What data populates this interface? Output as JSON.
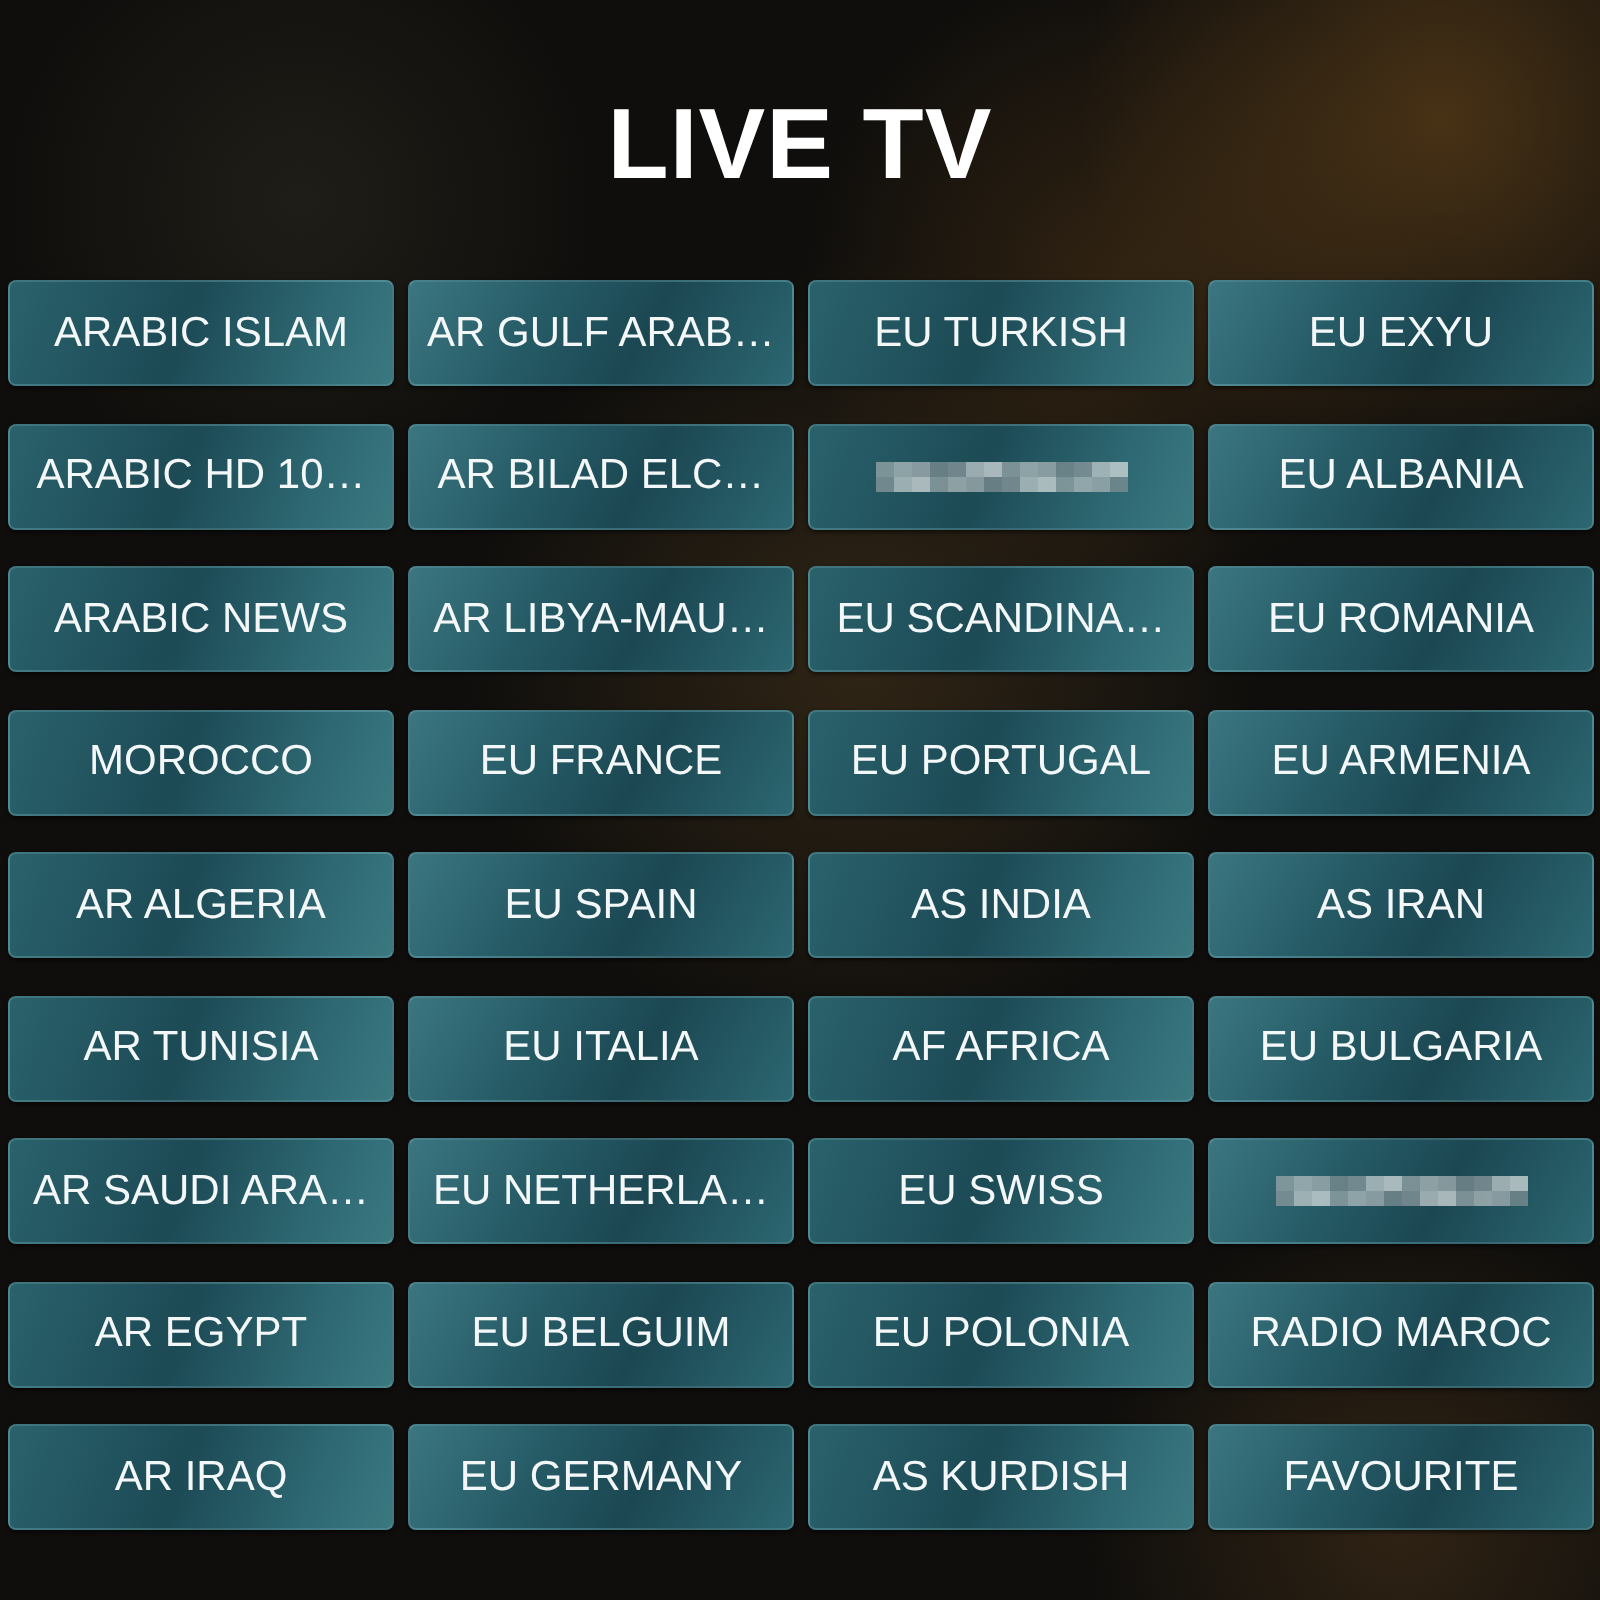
{
  "title": "LIVE TV",
  "categories": [
    {
      "kind": "label",
      "label": "ARABIC ISLAM"
    },
    {
      "kind": "label",
      "label": "AR GULF ARAB…"
    },
    {
      "kind": "label",
      "label": "EU TURKISH"
    },
    {
      "kind": "label",
      "label": "EU EXYU"
    },
    {
      "kind": "label",
      "label": "ARABIC HD 10…"
    },
    {
      "kind": "label",
      "label": "AR BILAD ELC…"
    },
    {
      "kind": "blurred"
    },
    {
      "kind": "label",
      "label": "EU ALBANIA"
    },
    {
      "kind": "label",
      "label": "ARABIC NEWS"
    },
    {
      "kind": "label",
      "label": "AR LIBYA-MAU…"
    },
    {
      "kind": "label",
      "label": "EU SCANDINA…"
    },
    {
      "kind": "label",
      "label": "EU ROMANIA"
    },
    {
      "kind": "label",
      "label": "MOROCCO"
    },
    {
      "kind": "label",
      "label": "EU FRANCE"
    },
    {
      "kind": "label",
      "label": "EU PORTUGAL"
    },
    {
      "kind": "label",
      "label": "EU ARMENIA"
    },
    {
      "kind": "label",
      "label": "AR ALGERIA"
    },
    {
      "kind": "label",
      "label": "EU SPAIN"
    },
    {
      "kind": "label",
      "label": "AS INDIA"
    },
    {
      "kind": "label",
      "label": "AS IRAN"
    },
    {
      "kind": "label",
      "label": "AR TUNISIA"
    },
    {
      "kind": "label",
      "label": "EU ITALIA"
    },
    {
      "kind": "label",
      "label": "AF AFRICA"
    },
    {
      "kind": "label",
      "label": "EU BULGARIA"
    },
    {
      "kind": "label",
      "label": "AR SAUDI ARA…"
    },
    {
      "kind": "label",
      "label": "EU NETHERLA…"
    },
    {
      "kind": "label",
      "label": "EU SWISS"
    },
    {
      "kind": "blurred"
    },
    {
      "kind": "label",
      "label": "AR EGYPT"
    },
    {
      "kind": "label",
      "label": "EU BELGUIM"
    },
    {
      "kind": "label",
      "label": "EU POLONIA"
    },
    {
      "kind": "label",
      "label": "RADIO MAROC"
    },
    {
      "kind": "label",
      "label": "AR IRAQ"
    },
    {
      "kind": "label",
      "label": "EU GERMANY"
    },
    {
      "kind": "label",
      "label": "AS KURDISH"
    },
    {
      "kind": "label",
      "label": "FAVOURITE"
    }
  ]
}
